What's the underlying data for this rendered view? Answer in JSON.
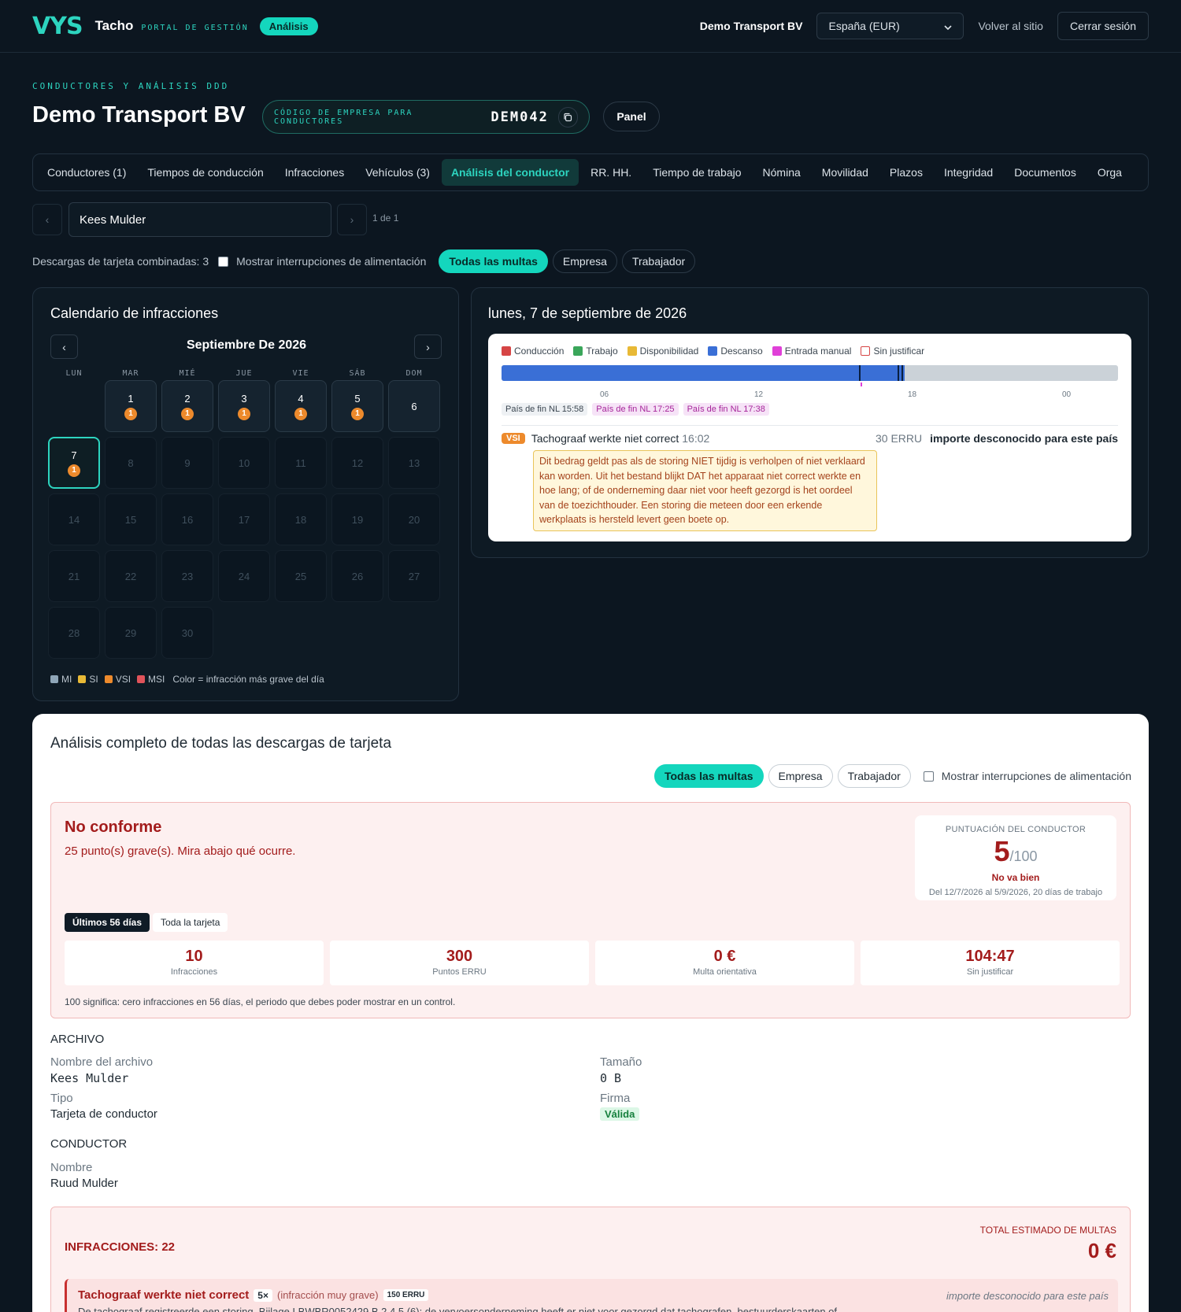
{
  "topbar": {
    "logo_mark": "VYS",
    "app_name": "Tacho",
    "app_sub": "PORTAL DE GESTIÓN",
    "mode_pill": "Análisis",
    "company": "Demo Transport BV",
    "region_select": "España (EUR)",
    "back_link": "Volver al sitio",
    "logout": "Cerrar sesión"
  },
  "header": {
    "kicker": "CONDUCTORES Y ANÁLISIS DDD",
    "title": "Demo Transport BV",
    "code_label": "CÓDIGO DE EMPRESA PARA CONDUCTORES",
    "code_value": "DEM042",
    "panel_button": "Panel"
  },
  "tabs": [
    "Conductores (1)",
    "Tiempos de conducción",
    "Infracciones",
    "Vehículos (3)",
    "Análisis del conductor",
    "RR. HH.",
    "Tiempo de trabajo",
    "Nómina",
    "Movilidad",
    "Plazos",
    "Integridad",
    "Documentos",
    "Orga"
  ],
  "active_tab": "Análisis del conductor",
  "driver_selector": {
    "prev": "‹",
    "next": "›",
    "value": "Kees Mulder",
    "count": "1 de 1"
  },
  "filters": {
    "combined": "Descargas de tarjeta combinadas: 3",
    "power_label": "Mostrar interrupciones de alimentación",
    "chips": [
      "Todas las multas",
      "Empresa",
      "Trabajador"
    ],
    "active_chip": "Todas las multas"
  },
  "calendar": {
    "title": "Calendario de infracciones",
    "prev": "‹",
    "next": "›",
    "month": "Septiembre De 2026",
    "weekdays": [
      "LUN",
      "MAR",
      "MIÉ",
      "JUE",
      "VIE",
      "SÁB",
      "DOM"
    ],
    "first_weekday_offset": 1,
    "days_in_month": 30,
    "selected_day": 7,
    "day_badges": {
      "1": 1,
      "2": 1,
      "3": 1,
      "4": 1,
      "5": 1,
      "7": 1
    },
    "active_days": [
      1,
      2,
      3,
      4,
      5,
      6
    ],
    "legend": [
      {
        "label": "MI",
        "color": "#8fa6b8"
      },
      {
        "label": "SI",
        "color": "#e8b936"
      },
      {
        "label": "VSI",
        "color": "#ed8a2c"
      },
      {
        "label": "MSI",
        "color": "#e0535a"
      }
    ],
    "legend_note": "Color = infracción más grave del día"
  },
  "day_detail": {
    "title": "lunes, 7 de septiembre de 2026",
    "legend": [
      {
        "label": "Conducción",
        "color": "#d64545"
      },
      {
        "label": "Trabajo",
        "color": "#3aa65a"
      },
      {
        "label": "Disponibilidad",
        "color": "#e8b936"
      },
      {
        "label": "Descanso",
        "color": "#3a6fd6"
      },
      {
        "label": "Entrada manual",
        "color": "#e040d8"
      },
      {
        "label": "Sin justificar",
        "color": "#ffffff"
      }
    ],
    "ticks": [
      "06",
      "12",
      "18",
      "00"
    ],
    "tags": [
      {
        "text": "País de fin NL 15:58",
        "style": "plain"
      },
      {
        "text": "País de fin NL 17:25",
        "style": "pink"
      },
      {
        "text": "País de fin NL 17:38",
        "style": "pink"
      }
    ],
    "violation": {
      "severity": "VSI",
      "name": "Tachograaf werkte niet correct",
      "time": "16:02",
      "erru": "30 ERRU",
      "amount": "importe desconocido para este país",
      "note": "Dit bedrag geldt pas als de storing NIET tijdig is verholpen of niet verklaard kan worden. Uit het bestand blijkt DAT het apparaat niet correct werkte en hoe lang; of de onderneming daar niet voor heeft gezorgd is het oordeel van de toezichthouder. Een storing die meteen door een erkende werkplaats is hersteld levert geen boete op."
    }
  },
  "full_analysis": {
    "title": "Análisis completo de todas las descargas de tarjeta",
    "chips": [
      "Todas las multas",
      "Empresa",
      "Trabajador"
    ],
    "power_label": "Mostrar interrupciones de alimentación",
    "status": {
      "title": "No conforme",
      "subtitle": "25 punto(s) grave(s). Mira abajo qué ocurre.",
      "score_label": "PUNTUACIÓN DEL CONDUCTOR",
      "score": "5",
      "score_max": "/100",
      "score_status": "No va bien",
      "period": "Del 12/7/2026 al 5/9/2026, 20 días de trabajo",
      "segments": [
        "Últimos 56 días",
        "Toda la tarjeta"
      ],
      "stats": [
        {
          "value": "10",
          "label": "Infracciones"
        },
        {
          "value": "300",
          "label": "Puntos ERRU"
        },
        {
          "value": "0 €",
          "label": "Multa orientativa"
        },
        {
          "value": "104:47",
          "label": "Sin justificar"
        }
      ],
      "footnote": "100 significa: cero infracciones en 56 días, el periodo que debes poder mostrar en un control."
    },
    "archivo": {
      "heading": "ARCHIVO",
      "file_name_label": "Nombre del archivo",
      "file_name": "Kees Mulder",
      "size_label": "Tamaño",
      "size": "0 B",
      "type_label": "Tipo",
      "type": "Tarjeta de conductor",
      "signature_label": "Firma",
      "signature": "Válida"
    },
    "conductor": {
      "heading": "CONDUCTOR",
      "name_label": "Nombre",
      "name": "Ruud Mulder"
    },
    "infracciones": {
      "title": "INFRACCIONES: 22",
      "total_label": "TOTAL ESTIMADO DE MULTAS",
      "total": "0 €",
      "first_item": {
        "name": "Tachograaf werkte niet correct",
        "count": "5×",
        "kind": "(infracción muy grave)",
        "erru": "150 ERRU",
        "amount": "importe desconocido para este país",
        "description": "De tachograaf registreerde een storing. Bijlage I BWBR0052429 B.2.4.5 (6): de vervoersonderneming heeft er niet voor gezorgd dat tachografen, bestuurderskaarten of"
      }
    }
  }
}
